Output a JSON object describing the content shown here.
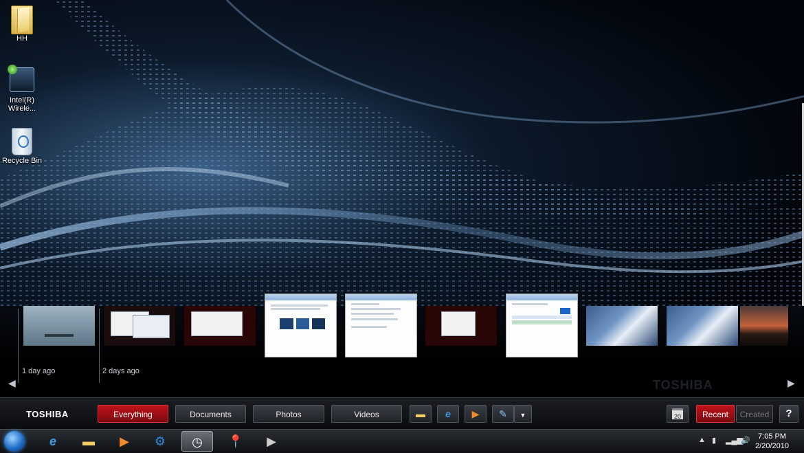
{
  "desktop": {
    "icons": [
      {
        "label": "HH"
      },
      {
        "label": "Intel(R) Wirele..."
      },
      {
        "label": "Recycle Bin"
      }
    ]
  },
  "flip_strip": {
    "time_labels": [
      "1 day ago",
      "2 days ago"
    ],
    "watermark": "TOSHIBA"
  },
  "toolbar": {
    "brand": "TOSHIBA",
    "filters": [
      "Everything",
      "Documents",
      "Photos",
      "Videos"
    ],
    "active_filter": "Everything",
    "calendar_day": "20",
    "sort_recent": "Recent",
    "sort_created": "Created",
    "help": "?",
    "accent": "#c0111a"
  },
  "taskbar": {
    "time": "7:05 PM",
    "date": "2/20/2010"
  }
}
